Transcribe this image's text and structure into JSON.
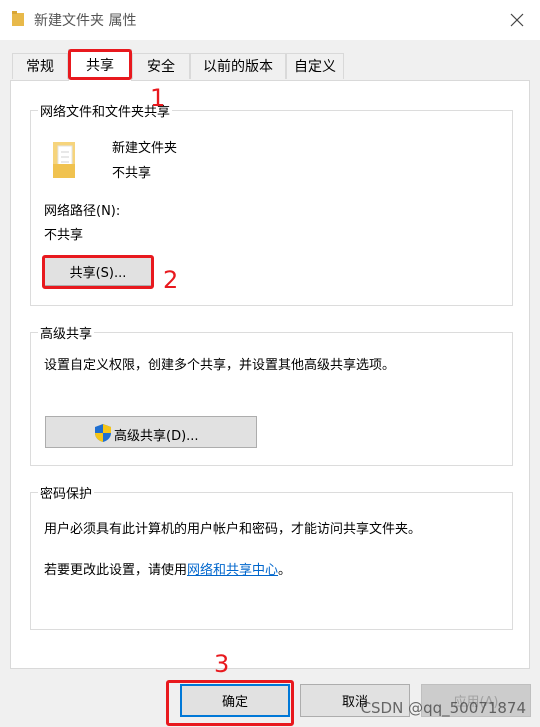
{
  "window": {
    "title": "新建文件夹 属性",
    "close_icon": "close-icon"
  },
  "tabs": [
    {
      "label": "常规"
    },
    {
      "label": "共享",
      "active": true
    },
    {
      "label": "安全"
    },
    {
      "label": "以前的版本"
    },
    {
      "label": "自定义"
    }
  ],
  "network_sharing": {
    "title": "网络文件和文件夹共享",
    "folder_name": "新建文件夹",
    "folder_status": "不共享",
    "path_label": "网络路径(N):",
    "path_value": "不共享",
    "share_button": "共享(S)..."
  },
  "advanced_sharing": {
    "title": "高级共享",
    "description": "设置自定义权限，创建多个共享，并设置其他高级共享选项。",
    "button": "高级共享(D)...",
    "button_icon": "uac-shield-icon"
  },
  "password_protection": {
    "title": "密码保护",
    "line1": "用户必须具有此计算机的用户帐户和密码，才能访问共享文件夹。",
    "line2_prefix": "若要更改此设置，请使用",
    "line2_link": "网络和共享中心",
    "line2_suffix": "。"
  },
  "footer": {
    "ok": "确定",
    "cancel": "取消",
    "apply": "应用(A)"
  },
  "annotations": {
    "step1": "1",
    "step2": "2",
    "step3": "3",
    "color": "#e8191e"
  },
  "watermark": "CSDN @qq_50071874"
}
